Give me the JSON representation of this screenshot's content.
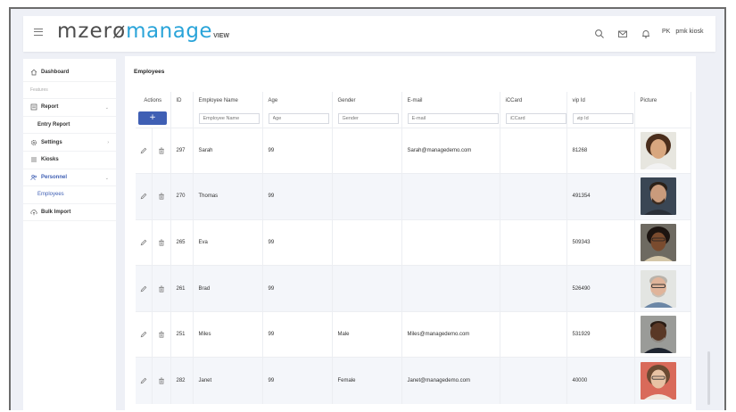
{
  "app": {
    "logo_main": "mzerø",
    "logo_brand": "manage",
    "logo_sub": "VIEW",
    "user_initials": "PK",
    "user_name": "pmk kiosk"
  },
  "sidebar": {
    "items": [
      {
        "label": "Dashboard"
      },
      {
        "label": "Features"
      },
      {
        "label": "Report"
      },
      {
        "label": "Entry Report"
      },
      {
        "label": "Settings"
      },
      {
        "label": "Kiosks"
      },
      {
        "label": "Personnel"
      },
      {
        "label": "Employees"
      },
      {
        "label": "Bulk Import"
      }
    ]
  },
  "main": {
    "title": "Employees",
    "columns": [
      "Actions",
      "ID",
      "Employee Name",
      "Age",
      "Gender",
      "E-mail",
      "iCCard",
      "vip Id",
      "Picture"
    ],
    "filters": {
      "name": "Employee Name",
      "age": "Age",
      "gender": "Gender",
      "email": "E-mail",
      "card": "iCCard",
      "vip": "vip Id"
    },
    "add_label": "+",
    "rows": [
      {
        "id": "297",
        "name": "Sarah",
        "age": "99",
        "gender": "",
        "email": "Sarah@managedemo.com",
        "card": "",
        "vip": "81268"
      },
      {
        "id": "270",
        "name": "Thomas",
        "age": "99",
        "gender": "",
        "email": "",
        "card": "",
        "vip": "491354"
      },
      {
        "id": "265",
        "name": "Eva",
        "age": "99",
        "gender": "",
        "email": "",
        "card": "",
        "vip": "509343"
      },
      {
        "id": "261",
        "name": "Brad",
        "age": "99",
        "gender": "",
        "email": "",
        "card": "",
        "vip": "526490"
      },
      {
        "id": "251",
        "name": "Miles",
        "age": "99",
        "gender": "Male",
        "email": "Miles@managedemo.com",
        "card": "",
        "vip": "531929"
      },
      {
        "id": "282",
        "name": "Janet",
        "age": "99",
        "gender": "Female",
        "email": "Janet@managedemo.com",
        "card": "",
        "vip": "40000"
      }
    ]
  },
  "colors": {
    "accent": "#3f5fb4",
    "brand": "#2aa4d9",
    "row_alt": "#f4f6fa"
  },
  "icons": [
    "menu-icon",
    "search-icon",
    "mail-icon",
    "bell-icon",
    "home-icon",
    "report-icon",
    "gear-icon",
    "list-icon",
    "people-icon",
    "upload-icon",
    "pencil-icon",
    "trash-icon"
  ]
}
